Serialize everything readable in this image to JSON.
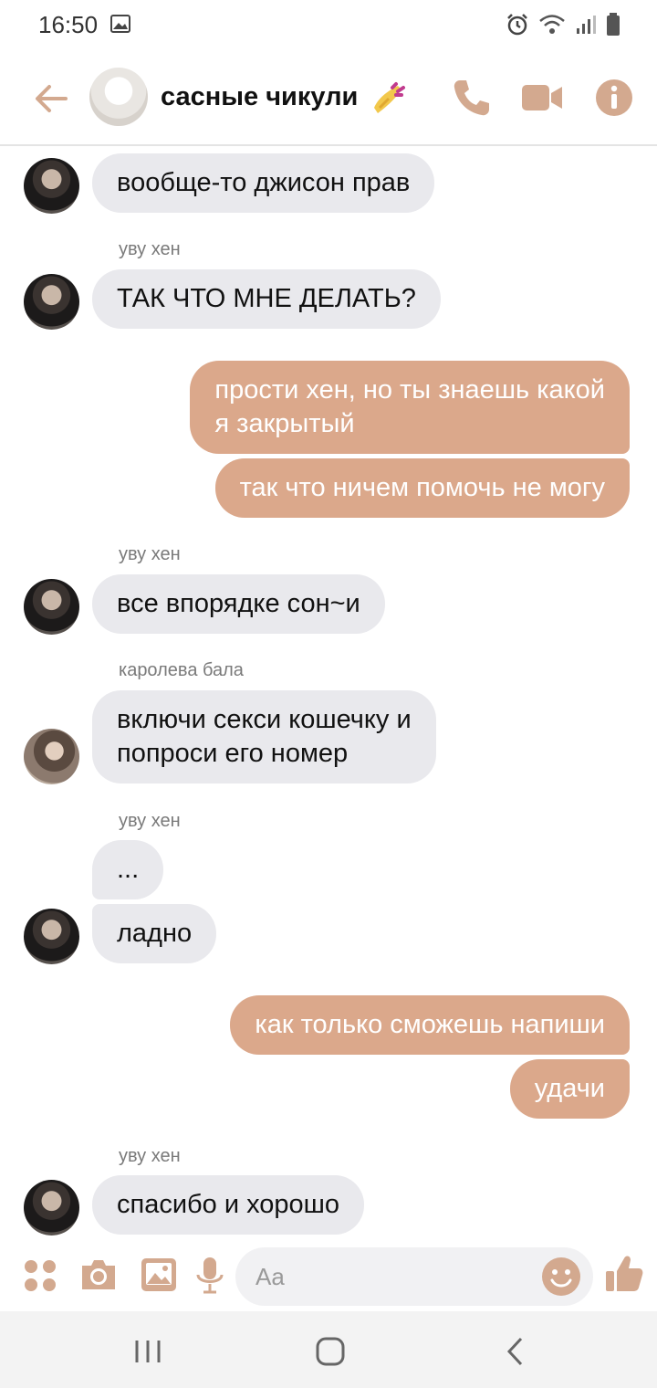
{
  "status_bar": {
    "time": "16:50"
  },
  "header": {
    "group_name": "сасные чикули"
  },
  "messages": [
    {
      "text": "вообще-то джисон прав"
    },
    {
      "sender": "уву хен",
      "text": "ТАК ЧТО МНЕ ДЕЛАТЬ?"
    },
    {
      "line1": "прости хен, но ты знаешь какой",
      "line2": "я закрытый"
    },
    {
      "text": "так что ничем помочь не могу"
    },
    {
      "sender": "уву хен",
      "text": "все впорядке сон~и"
    },
    {
      "sender": "каролева бала",
      "line1": "включи секси кошечку и",
      "line2": "попроси его номер"
    },
    {
      "sender": "уву хен",
      "text": "..."
    },
    {
      "text": "ладно"
    },
    {
      "text": "как только сможешь напиши"
    },
    {
      "text": "удачи"
    },
    {
      "sender": "уву хен",
      "text": "спасибо и хорошо"
    }
  ],
  "composer": {
    "placeholder": "Aa"
  },
  "colors": {
    "accent": "#d3a98f",
    "outgoing_bubble": "#dba88b",
    "incoming_bubble": "#e9e9ed"
  },
  "icons": [
    "back-arrow",
    "phone",
    "video-camera",
    "info",
    "apps",
    "camera",
    "gallery",
    "microphone",
    "emoji",
    "thumbs-up",
    "recents",
    "home",
    "back"
  ]
}
